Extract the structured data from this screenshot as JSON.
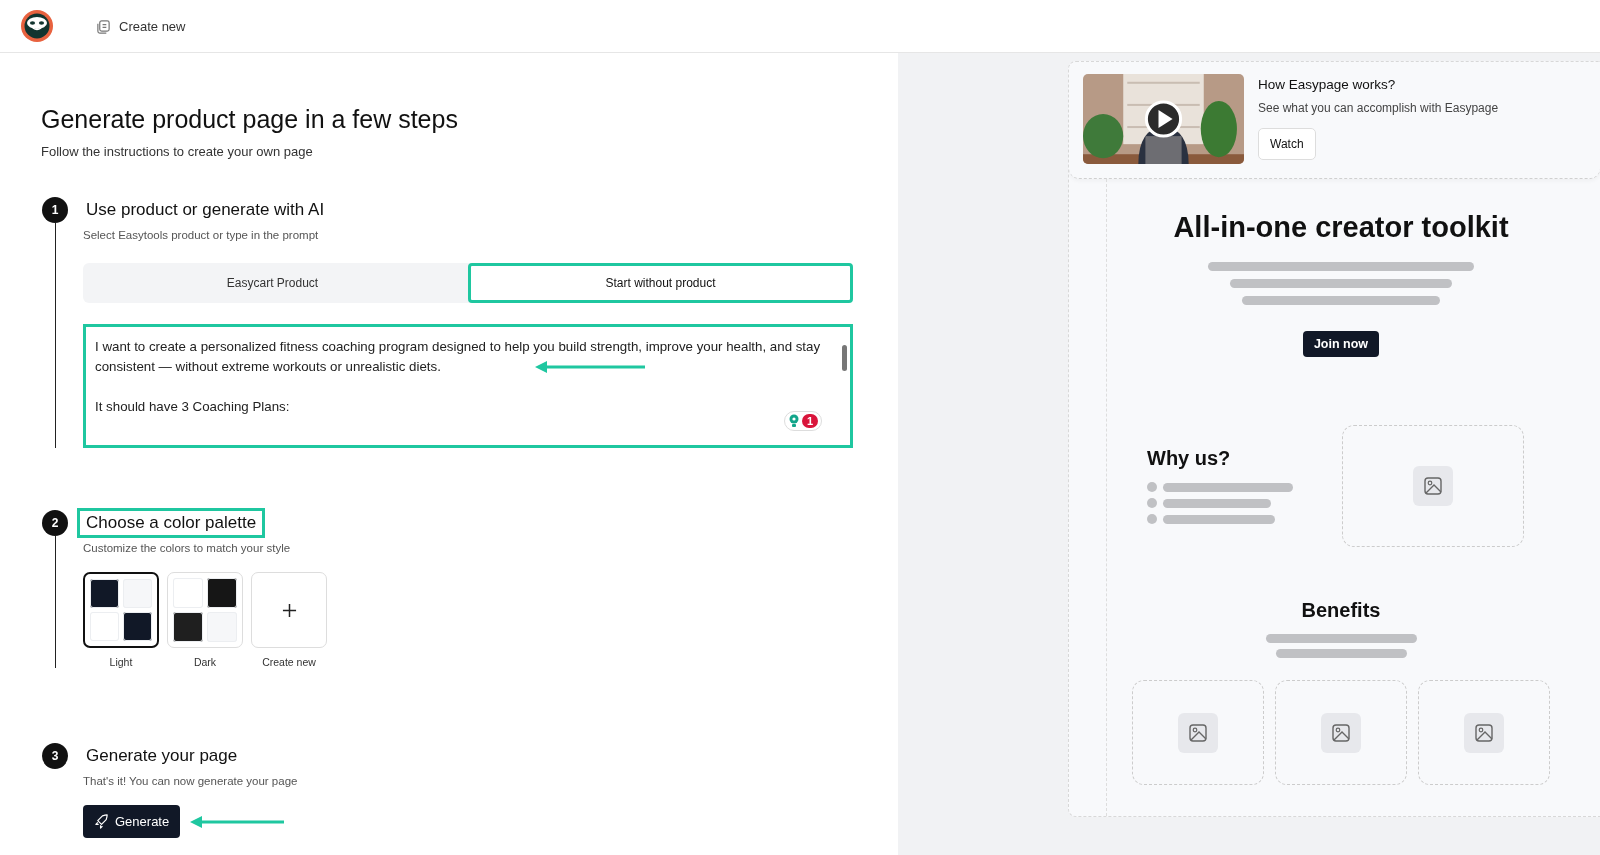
{
  "header": {
    "create_new": "Create new"
  },
  "page": {
    "title": "Generate product page in a few steps",
    "subtitle": "Follow the instructions to create your own page"
  },
  "steps": [
    {
      "number": "1",
      "kind": "prompt",
      "title": "Use product or generate with AI",
      "hint": "Select Easytools product or type in the prompt",
      "highlighted": false,
      "tabs": [
        {
          "label": "Easycart Product",
          "selected": false
        },
        {
          "label": "Start without product",
          "selected": true
        }
      ],
      "prompt": {
        "value": "I want to create a personalized fitness coaching program designed to help you build strength, improve your health, and stay consistent — without extreme workouts or unrealistic diets.\n\nIt should have 3 Coaching Plans:",
        "issue_count": "1"
      }
    },
    {
      "number": "2",
      "kind": "palette",
      "title": "Choose a color palette",
      "hint": "Customize the colors to match your style",
      "highlighted": true,
      "palettes": [
        {
          "label": "Light",
          "selected": true,
          "swatches": [
            {
              "color": "#111827"
            },
            {
              "color": "#f6f7f9"
            },
            {
              "color": "#ffffff"
            },
            {
              "color": "#111827"
            }
          ]
        },
        {
          "label": "Dark",
          "selected": false,
          "swatches": [
            {
              "color": "#ffffff"
            },
            {
              "color": "#161616"
            },
            {
              "color": "#1f1f1f"
            },
            {
              "color": "#f6f7f9"
            }
          ]
        }
      ],
      "create_new": "Create new"
    },
    {
      "number": "3",
      "kind": "generate",
      "title": "Generate your page",
      "hint": "That's it! You can now generate your page",
      "highlighted": false,
      "button": "Generate"
    }
  ],
  "video_card": {
    "title": "How Easypage works?",
    "text": "See what you can accomplish with Easypage",
    "button": "Watch"
  },
  "preview": {
    "hero_title": "All-in-one creator toolkit",
    "hero_button": "Join now",
    "why_title": "Why us?",
    "benefits_title": "Benefits"
  }
}
